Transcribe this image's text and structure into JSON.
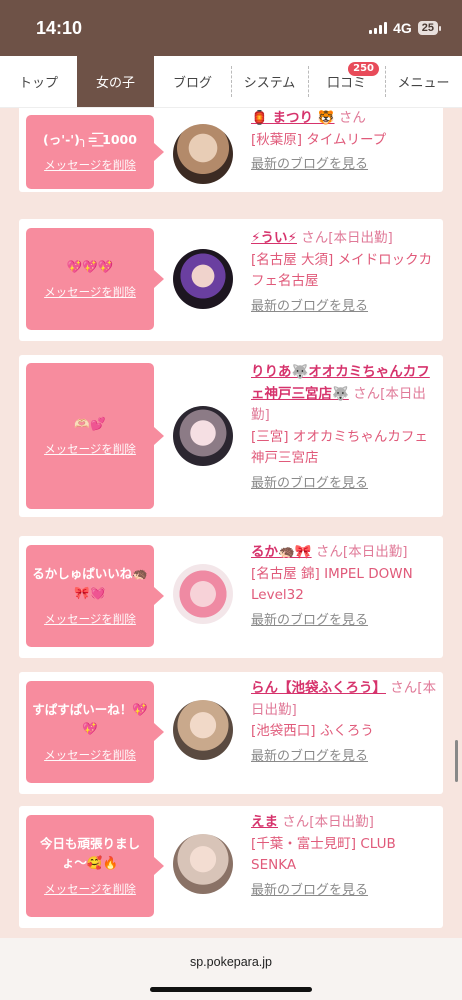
{
  "status": {
    "time": "14:10",
    "network": "4G",
    "battery": "25"
  },
  "nav": {
    "items": [
      {
        "label": "トップ"
      },
      {
        "label": "女の子"
      },
      {
        "label": "ブログ"
      },
      {
        "label": "システム"
      },
      {
        "label": "口コミ",
        "badge": "250"
      },
      {
        "label": "メニュー"
      }
    ],
    "active": "女の子"
  },
  "cards": [
    {
      "message": "(っ'-')╮=͟͟͞͞ 1000",
      "delete_label": "メッセージを削除",
      "name": "🏮 まつり 🐯",
      "san": "さん",
      "shop": "[秋葉原] タイムリープ",
      "blog": "最新のブログを見る"
    },
    {
      "message": "💖💖💖",
      "delete_label": "メッセージを削除",
      "name": "⚡うい⚡",
      "san": "さん[本日出勤]",
      "shop": "[名古屋 大須] メイドロックカフェ名古屋",
      "blog": "最新のブログを見る"
    },
    {
      "message": "🫶🏻💕",
      "delete_label": "メッセージを削除",
      "name": "りりあ🐺オオカミちゃんカフェ神戸三宮店🐺",
      "san": "さん[本日出勤]",
      "shop": "[三宮] オオカミちゃんカフェ神戸三宮店",
      "blog": "最新のブログを見る"
    },
    {
      "message": "るかしゅぱいいね🦔🎀💓",
      "delete_label": "メッセージを削除",
      "name": "るか🦔🎀",
      "san": "さん[本日出勤]",
      "shop": "[名古屋 錦] IMPEL DOWN Level32",
      "blog": "最新のブログを見る"
    },
    {
      "message": "すぱすぱいーね！💖💖",
      "delete_label": "メッセージを削除",
      "name": "らん【池袋ふくろう】",
      "san": "さん[本日出勤]",
      "shop": "[池袋西口] ふくろう",
      "blog": "最新のブログを見る"
    },
    {
      "message": "今日も頑張りましょ〜🥰🔥",
      "delete_label": "メッセージを削除",
      "name": "えま",
      "san": "さん[本日出勤]",
      "shop": "[千葉・富士見町] CLUB SENKA",
      "blog": "最新のブログを見る"
    }
  ],
  "browser": {
    "url": "sp.pokepara.jp"
  }
}
